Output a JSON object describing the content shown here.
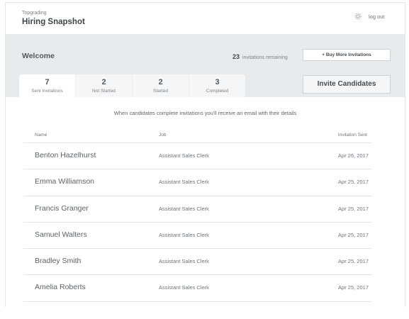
{
  "header": {
    "brand_sub": "Topgrading",
    "app_title": "Hiring Snapshot",
    "settings_icon": "gear-icon",
    "logout_label": "log out"
  },
  "summary": {
    "welcome": "Welcome",
    "invitations_remaining_count": "23",
    "invitations_remaining_label": "invitations remaining",
    "buy_more_label": "+ Buy More Invitations",
    "invite_candidates_label": "Invite Candidates"
  },
  "tabs": [
    {
      "count": "7",
      "label": "Sent Invitations",
      "active": true
    },
    {
      "count": "2",
      "label": "Not Started",
      "active": false
    },
    {
      "count": "2",
      "label": "Started",
      "active": false
    },
    {
      "count": "3",
      "label": "Completed",
      "active": false
    }
  ],
  "notice": "When candidates complete invitations you'll receive an email with their details",
  "table": {
    "columns": {
      "name": "Name",
      "job": "Job",
      "sent": "Invitation Sent"
    },
    "rows": [
      {
        "name": "Benton Hazelhurst",
        "job": "Assistant Sales Clerk",
        "sent": "Apr 26, 2017"
      },
      {
        "name": "Emma Williamson",
        "job": "Assistant Sales Clerk",
        "sent": "Apr 25, 2017"
      },
      {
        "name": "Francis Granger",
        "job": "Assistant Sales Clerk",
        "sent": "Apr 25, 2017"
      },
      {
        "name": "Samuel Walters",
        "job": "Assistant Sales Clerk",
        "sent": "Apr 25, 2017"
      },
      {
        "name": "Bradley Smith",
        "job": "Assistant Sales Clerk",
        "sent": "Apr 25, 2017"
      },
      {
        "name": "Amelia Roberts",
        "job": "Assistant Sales Clerk",
        "sent": "Apr 25, 2017"
      }
    ]
  }
}
